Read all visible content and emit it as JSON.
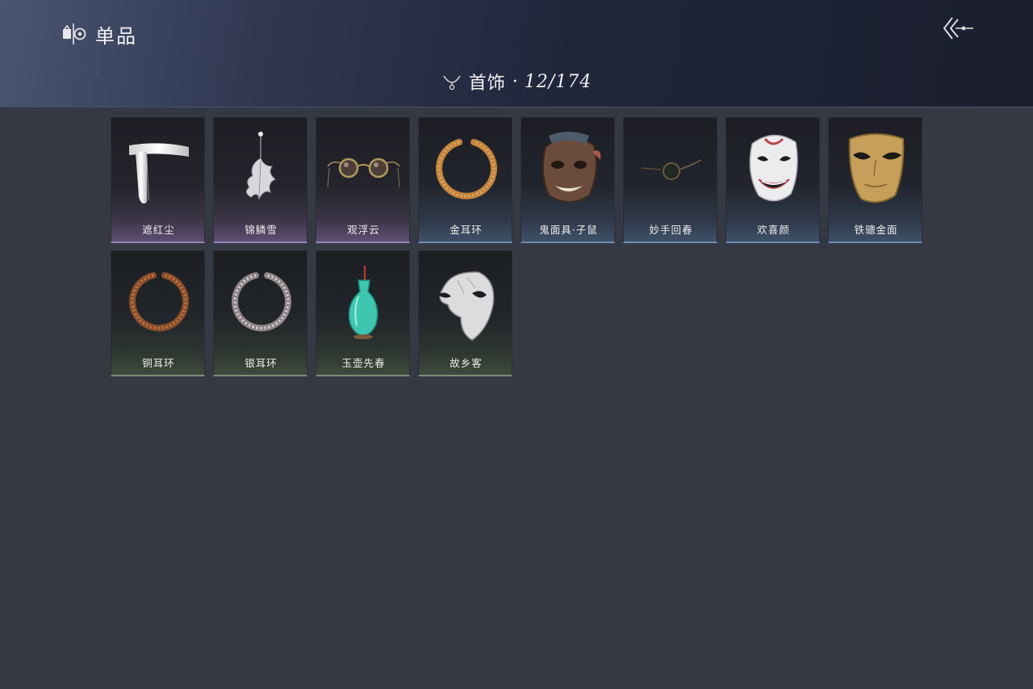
{
  "header": {
    "title": "单品",
    "title_icon": "collection-icon",
    "back_icon": "back-arrow-icon"
  },
  "category": {
    "icon": "necklace-icon",
    "label": "首饰",
    "separator": "·",
    "count": "12/174"
  },
  "rarity_colors": {
    "purple": "#9a84b8",
    "blue": "#6f8db4",
    "green": "#7d8c74"
  },
  "items": [
    {
      "name": "遮红尘",
      "rarity": "purple",
      "icon": "white-headband-icon"
    },
    {
      "name": "锦鳞雪",
      "rarity": "purple",
      "icon": "silver-leaf-earring-icon"
    },
    {
      "name": "观浮云",
      "rarity": "purple",
      "icon": "round-goggles-icon"
    },
    {
      "name": "金耳环",
      "rarity": "blue",
      "icon": "gold-earring-icon"
    },
    {
      "name": "鬼面具·子鼠",
      "rarity": "blue",
      "icon": "rat-demon-mask-icon"
    },
    {
      "name": "妙手回春",
      "rarity": "blue",
      "icon": "spectacles-icon"
    },
    {
      "name": "欢喜颜",
      "rarity": "blue",
      "icon": "smiling-opera-mask-icon"
    },
    {
      "name": "铁骢金面",
      "rarity": "blue",
      "icon": "gold-half-mask-icon"
    },
    {
      "name": "铜耳环",
      "rarity": "green",
      "icon": "copper-earring-icon"
    },
    {
      "name": "银耳环",
      "rarity": "green",
      "icon": "silver-earring-icon"
    },
    {
      "name": "玉壶先春",
      "rarity": "green",
      "icon": "jade-vase-icon"
    },
    {
      "name": "故乡客",
      "rarity": "green",
      "icon": "white-phantom-mask-icon"
    }
  ]
}
